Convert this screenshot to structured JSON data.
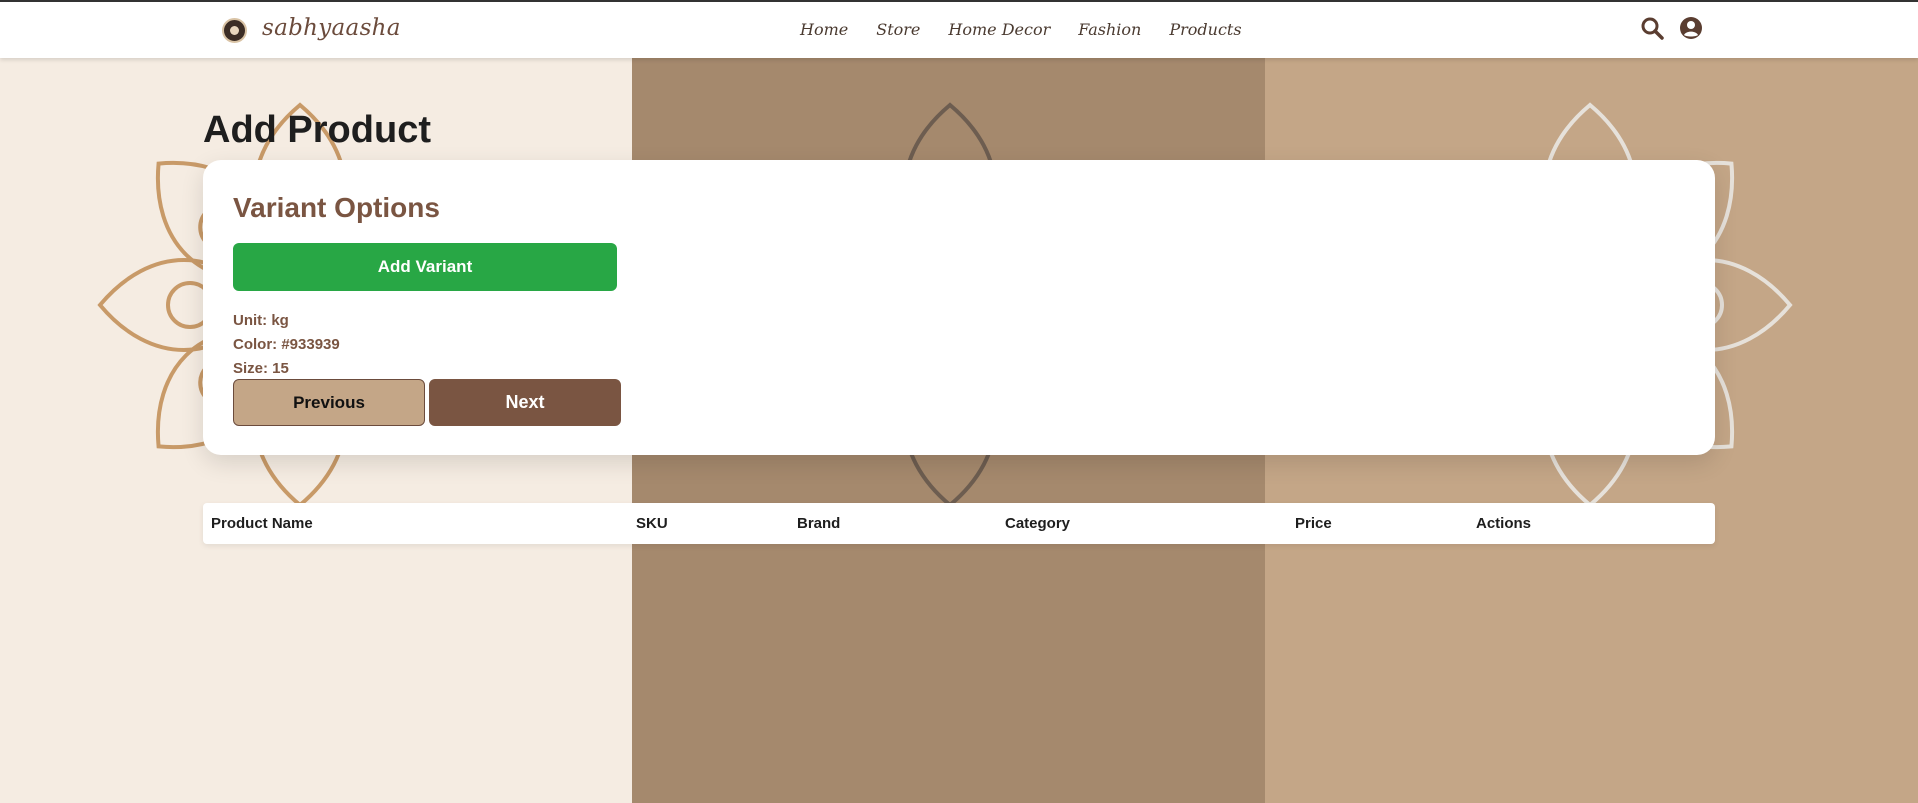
{
  "header": {
    "brand": "sabhyaasha",
    "nav": [
      "Home",
      "Store",
      "Home Decor",
      "Fashion",
      "Products"
    ],
    "icons": [
      "search-icon",
      "user-circle-icon"
    ]
  },
  "page": {
    "title": "Add Product"
  },
  "variant_card": {
    "title": "Variant Options",
    "add_button": "Add Variant",
    "unit": "Unit: kg",
    "color": "Color: #933939",
    "size": "Size: 15",
    "previous_button": "Previous",
    "next_button": "Next"
  },
  "table": {
    "columns": [
      "Product Name",
      "SKU",
      "Brand",
      "Category",
      "Price",
      "Actions"
    ]
  },
  "colors": {
    "accent_brown": "#7a5542",
    "accent_green": "#28a745",
    "bg_light": "#f5ece2",
    "bg_mid": "#a5896d",
    "bg_tan": "#c4a687"
  }
}
